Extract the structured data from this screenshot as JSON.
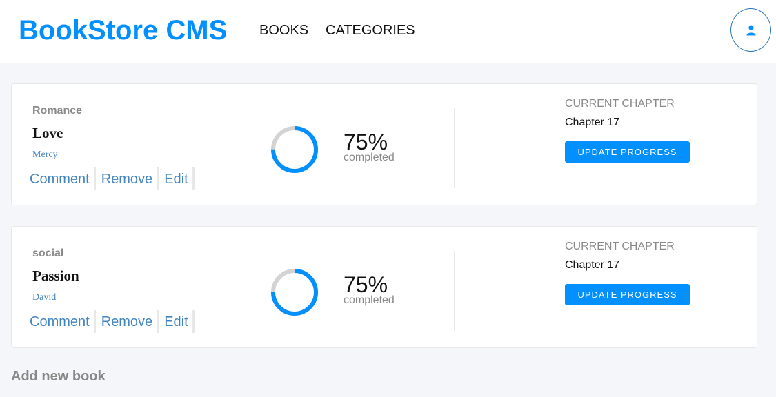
{
  "header": {
    "brand": "BookStore CMS",
    "nav": [
      {
        "label": "BOOKS"
      },
      {
        "label": "CATEGORIES"
      }
    ],
    "profile_icon": "user-icon"
  },
  "books": [
    {
      "category": "Romance",
      "title": "Love",
      "author": "Mercy",
      "actions": [
        "Comment",
        "Remove",
        "Edit"
      ],
      "progress_percent": 75,
      "progress_text": "75%",
      "completed_label": "completed",
      "current_chapter_label": "CURRENT CHAPTER",
      "current_chapter": "Chapter 17",
      "update_label": "UPDATE PROGRESS"
    },
    {
      "category": "social",
      "title": "Passion",
      "author": "David",
      "actions": [
        "Comment",
        "Remove",
        "Edit"
      ],
      "progress_percent": 75,
      "progress_text": "75%",
      "completed_label": "completed",
      "current_chapter_label": "CURRENT CHAPTER",
      "current_chapter": "Chapter 17",
      "update_label": "UPDATE PROGRESS"
    }
  ],
  "add_book": {
    "title": "Add new book"
  },
  "colors": {
    "accent": "#0290ff",
    "link": "#4386bf",
    "ring_track": "#d3d3d3",
    "background": "#f5f6fa"
  }
}
